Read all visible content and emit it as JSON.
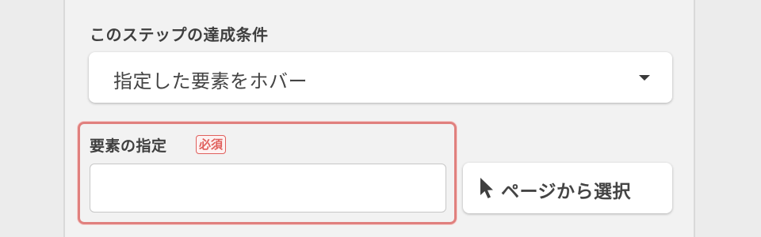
{
  "step_condition": {
    "label": "このステップの達成条件",
    "selected_value": "指定した要素をホバー"
  },
  "element_field": {
    "label": "要素の指定",
    "required_badge": "必須",
    "value": "",
    "placeholder": ""
  },
  "pick_button": {
    "label": "ページから選択",
    "icon": "cursor-pointer-icon"
  },
  "colors": {
    "error_border": "#e0807e",
    "required_red": "#e0605d",
    "panel_bg": "#f2f2f2",
    "text": "#3f3f3f"
  }
}
